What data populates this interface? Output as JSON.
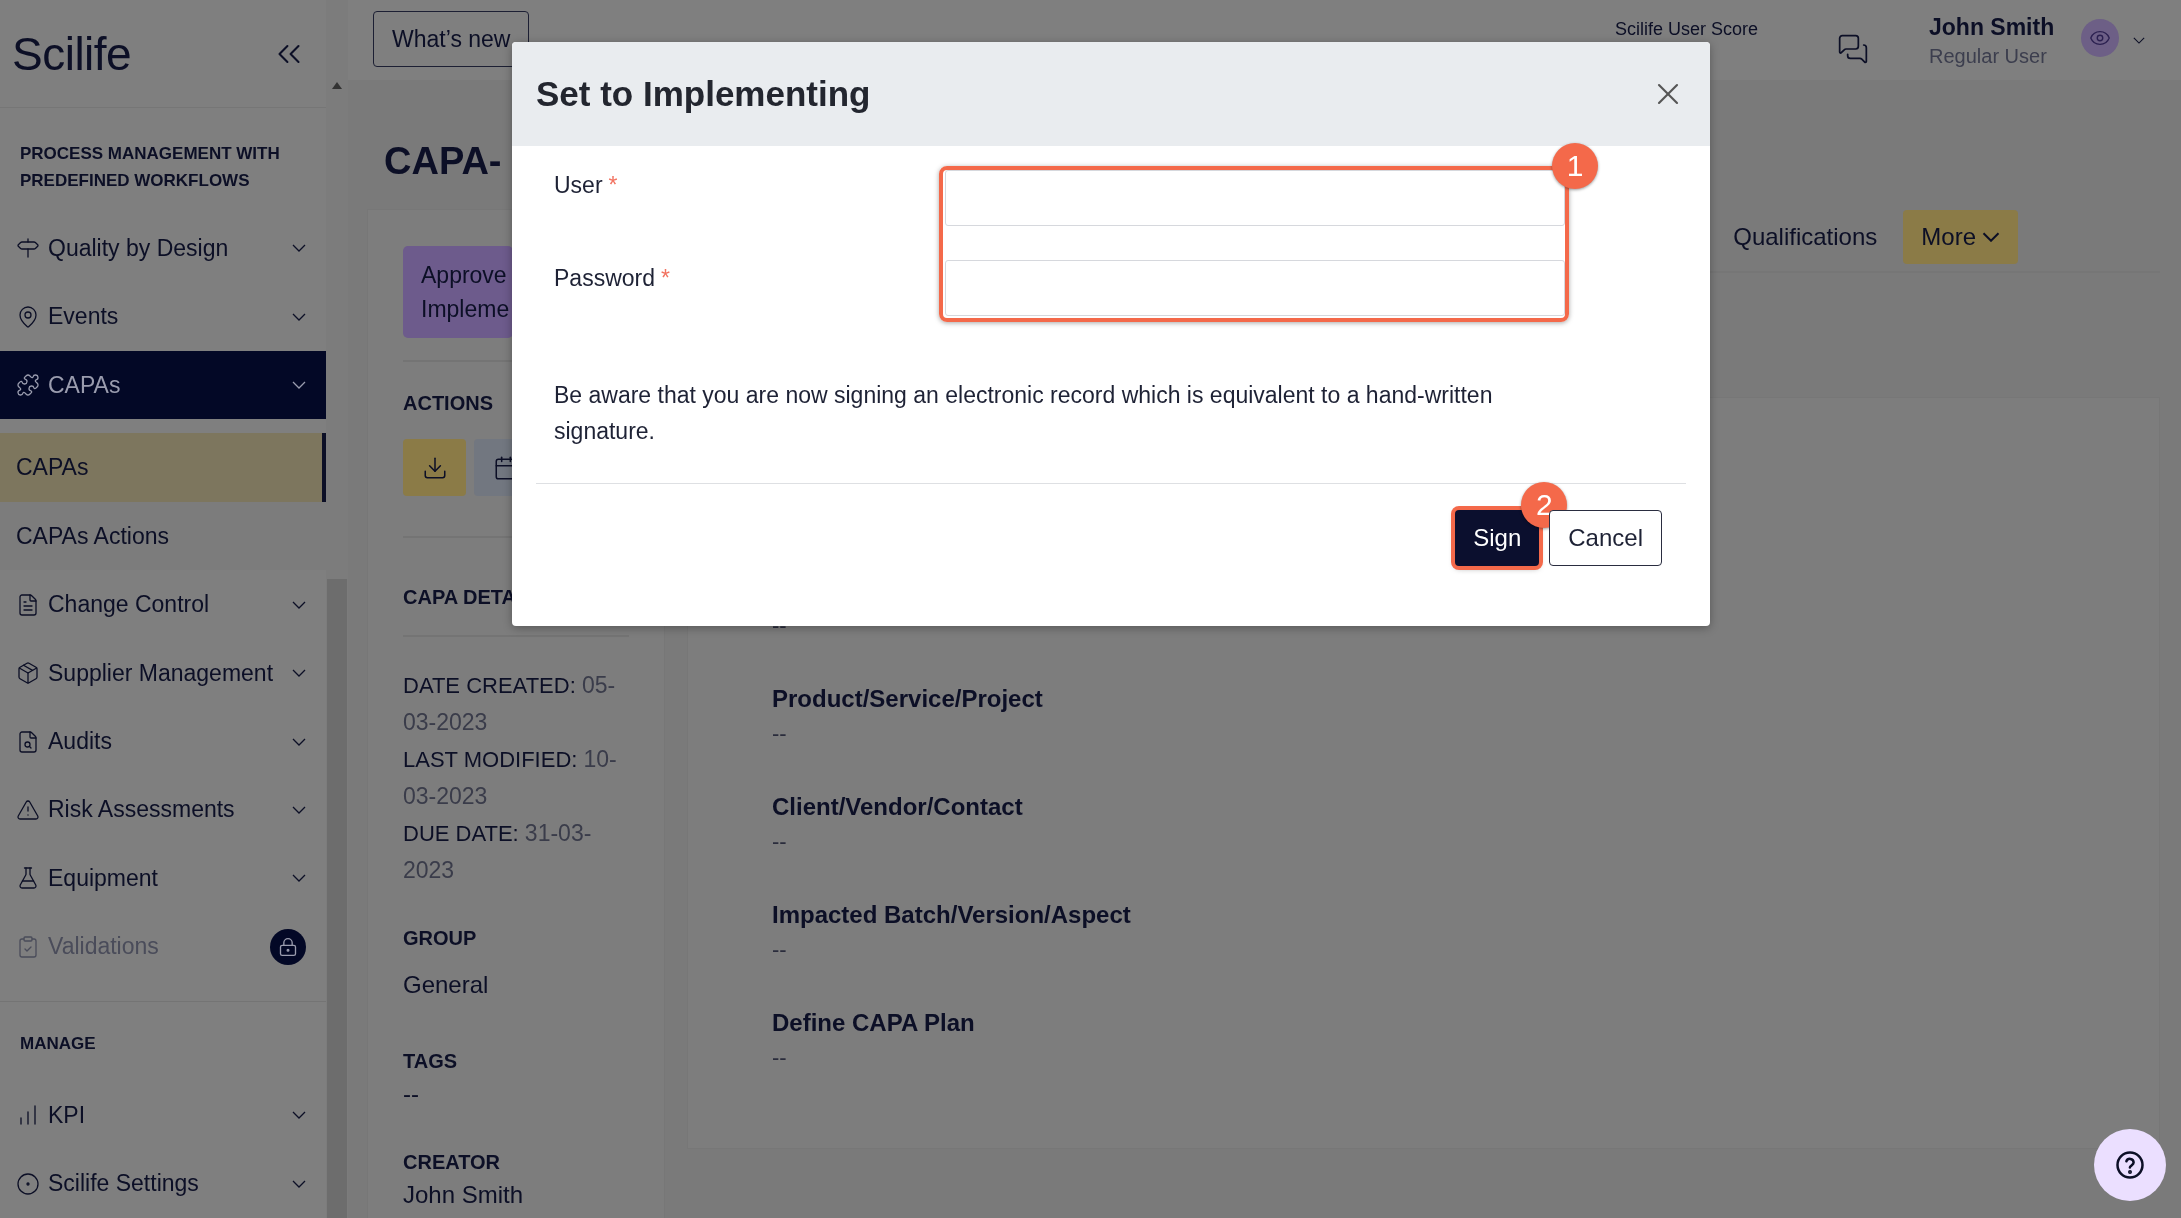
{
  "header": {
    "logo": "Scilife",
    "whats_new": "What’s new",
    "score_label": "Scilife User Score",
    "user_name": "John Smith",
    "user_role": "Regular User"
  },
  "sidebar": {
    "sections": [
      {
        "title": "PROCESS MANAGEMENT WITH PREDEFINED WORKFLOWS",
        "items": [
          {
            "label": "Quality by Design",
            "selected": false,
            "locked": false
          },
          {
            "label": "Events",
            "selected": false,
            "locked": false
          },
          {
            "label": "CAPAs",
            "selected": true,
            "locked": false,
            "children": [
              {
                "label": "CAPAs",
                "selected": true
              },
              {
                "label": "CAPAs Actions",
                "selected": false
              }
            ]
          },
          {
            "label": "Change Control",
            "selected": false,
            "locked": false
          },
          {
            "label": "Supplier Management",
            "selected": false,
            "locked": false
          },
          {
            "label": "Audits",
            "selected": false,
            "locked": false
          },
          {
            "label": "Risk Assessments",
            "selected": false,
            "locked": false
          },
          {
            "label": "Equipment",
            "selected": false,
            "locked": false
          },
          {
            "label": "Validations",
            "selected": false,
            "locked": true
          }
        ]
      },
      {
        "title": "MANAGE",
        "items": [
          {
            "label": "KPI",
            "selected": false,
            "locked": false
          },
          {
            "label": "Scilife Settings",
            "selected": false,
            "locked": false
          }
        ]
      }
    ]
  },
  "record": {
    "title": "CAPA-",
    "status": [
      "Approve",
      "Impleme"
    ],
    "actions_title": "ACTIONS",
    "details_title": "CAPA DETA",
    "dates": [
      {
        "label": "DATE CREATED:",
        "value": "05-03-2023"
      },
      {
        "label": "LAST MODIFIED:",
        "value": "10-03-2023"
      },
      {
        "label": "DUE DATE:",
        "value": "31-03-2023"
      }
    ],
    "meta": [
      {
        "label": "GROUP",
        "value": "General"
      },
      {
        "label": "TAGS",
        "value": "--"
      },
      {
        "label": "CREATOR",
        "value": "John Smith"
      }
    ],
    "tabs": [
      {
        "label": "Qualifications",
        "kind": "tab"
      },
      {
        "label": "More",
        "kind": "menu"
      }
    ],
    "fields": [
      {
        "value": "--"
      },
      {
        "label": "Product/Service/Project",
        "value": "--"
      },
      {
        "label": "Client/Vendor/Contact",
        "value": "--"
      },
      {
        "label": "Impacted Batch/Version/Aspect",
        "value": "--"
      },
      {
        "label": "Define CAPA Plan",
        "value": "--"
      }
    ]
  },
  "modal": {
    "title": "Set to Implementing",
    "fields_step": "1",
    "fields": [
      {
        "label": "User",
        "required_mark": "*"
      },
      {
        "label": "Password",
        "required_mark": "*"
      }
    ],
    "notice": "Be aware that you are now signing an electronic record which is equivalent to a hand-written signature.",
    "buttons": [
      {
        "label": "Sign",
        "kind": "primary",
        "step": "2"
      },
      {
        "label": "Cancel",
        "kind": "secondary"
      }
    ]
  }
}
